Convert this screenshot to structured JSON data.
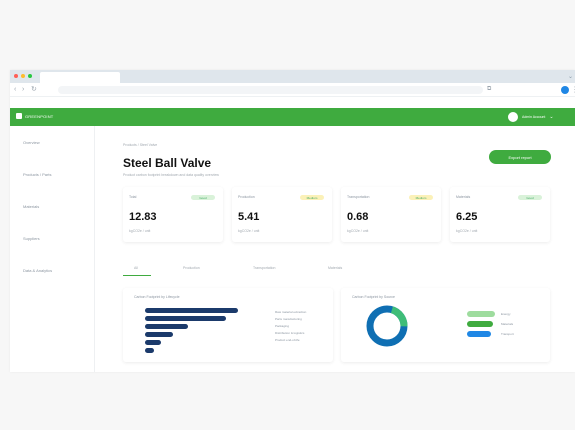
{
  "browser": {
    "dot_colors": [
      "#ff5f57",
      "#febc2e",
      "#28c840"
    ],
    "ext_icon": "puzzle-icon",
    "tabstrip_mark": "⌄"
  },
  "app": {
    "brand": "GREENPOINT",
    "user_name": "Admin Account"
  },
  "sidebar": {
    "items": [
      {
        "label": "Overview"
      },
      {
        "label": "Products / Parts"
      },
      {
        "label": "Materials"
      },
      {
        "label": "Suppliers"
      },
      {
        "label": "Data & Analytics"
      }
    ]
  },
  "page": {
    "breadcrumb": "Products  /  Steel Valve",
    "title": "Steel Ball Valve",
    "subtitle": "Product carbon footprint breakdown and data quality overview",
    "primary_action": "Export report"
  },
  "metrics": [
    {
      "label": "Total",
      "badge": "Good",
      "badge_color": "#d9f2d9",
      "value": "12.83",
      "unit": "kgCO2e / unit"
    },
    {
      "label": "Production",
      "badge": "Medium",
      "badge_color": "#fbf1b8",
      "value": "5.41",
      "unit": "kgCO2e / unit"
    },
    {
      "label": "Transportation",
      "badge": "Medium",
      "badge_color": "#fbf1b8",
      "value": "0.68",
      "unit": "kgCO2e / unit"
    },
    {
      "label": "Materials",
      "badge": "Good",
      "badge_color": "#d9f2d9",
      "value": "6.25",
      "unit": "kgCO2e / unit"
    }
  ],
  "tabs": [
    {
      "label": "All"
    },
    {
      "label": "Production"
    },
    {
      "label": "Transportation"
    },
    {
      "label": "Materials"
    }
  ],
  "bar_panel": {
    "title": "Carbon Footprint by Lifecycle",
    "bars": [
      {
        "value": 1.0
      },
      {
        "value": 0.87
      },
      {
        "value": 0.46
      },
      {
        "value": 0.3
      },
      {
        "value": 0.17
      },
      {
        "value": 0.1
      }
    ],
    "labels": [
      "Raw material extraction",
      "Parts manufacturing",
      "Packaging",
      "Distribution & logistics",
      "Product end-of-life"
    ]
  },
  "ring_panel": {
    "title": "Carbon Footprint by Source",
    "ring_colors": [
      "#0f6fb3",
      "#3fbd78"
    ],
    "legend": [
      {
        "label": "Energy",
        "color": "#9edc9e"
      },
      {
        "label": "Materials",
        "color": "#3fab3f"
      },
      {
        "label": "Transport",
        "color": "#1f87e5"
      }
    ]
  }
}
